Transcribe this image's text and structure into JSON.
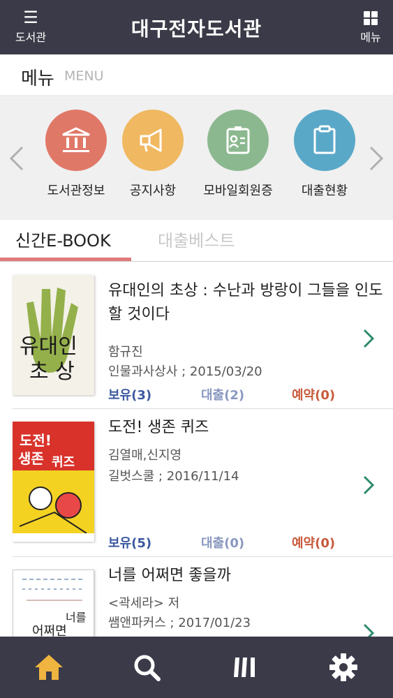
{
  "header": {
    "left_label": "도서관",
    "title": "대구전자도서관",
    "right_label": "메뉴"
  },
  "menu": {
    "title_ko": "메뉴",
    "title_en": "MENU"
  },
  "quick_menu": [
    {
      "label": "도서관정보",
      "color": "#e07868",
      "icon": "library-icon"
    },
    {
      "label": "공지사항",
      "color": "#f0b860",
      "icon": "megaphone-icon"
    },
    {
      "label": "모바일회원증",
      "color": "#8cb890",
      "icon": "id-card-icon"
    },
    {
      "label": "대출현황",
      "color": "#5aa8c8",
      "icon": "clipboard-icon"
    }
  ],
  "tabs": {
    "active": "신간E-BOOK",
    "inactive": "대출베스트"
  },
  "books": [
    {
      "title": "유대인의 초상 : 수난과 방랑이 그들을 인도할 것이다",
      "author": "함규진",
      "publisher": "인물과사상사 ; 2015/03/20",
      "own": "보유(3)",
      "loan": "대출(2)",
      "reserve": "예약(0)",
      "cover_text": "유대인의 초상"
    },
    {
      "title": "도전! 생존 퀴즈",
      "author": "김열매,신지영",
      "publisher": "길벗스쿨 ; 2016/11/14",
      "own": "보유(5)",
      "loan": "대출(0)",
      "reserve": "예약(0)",
      "cover_text": "도전! 생존 퀴즈"
    },
    {
      "title": "너를 어쩌면 좋을까",
      "author": "<곽세라> 저",
      "publisher": "쌤앤파커스 ; 2017/01/23",
      "cover_text": "너를 어쩌면"
    }
  ],
  "bottom_nav": [
    "home-icon",
    "search-icon",
    "bookshelf-icon",
    "settings-icon"
  ],
  "colors": {
    "header_bg": "#3a3a48",
    "accent_tab": "#e07a7a",
    "own": "#3c58a0",
    "loan": "#8a98c0",
    "reserve": "#c85a3c",
    "chevron": "#2e8a6e",
    "home_active": "#f0b440"
  }
}
